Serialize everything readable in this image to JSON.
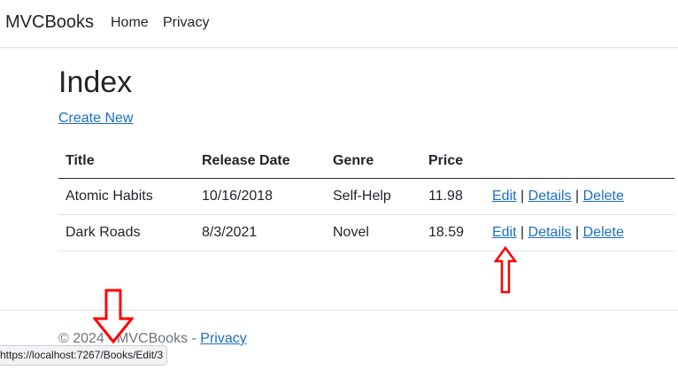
{
  "navbar": {
    "brand": "MVCBooks",
    "links": [
      "Home",
      "Privacy"
    ]
  },
  "main": {
    "heading": "Index",
    "create_link": "Create New",
    "table": {
      "headers": [
        "Title",
        "Release Date",
        "Genre",
        "Price"
      ],
      "rows": [
        {
          "title": "Atomic Habits",
          "release_date": "10/16/2018",
          "genre": "Self-Help",
          "price": "11.98"
        },
        {
          "title": "Dark Roads",
          "release_date": "8/3/2021",
          "genre": "Novel",
          "price": "18.59"
        }
      ],
      "actions": {
        "edit": "Edit",
        "details": "Details",
        "delete": "Delete",
        "separator": "|"
      }
    }
  },
  "footer": {
    "text": "© 2024 - MVCBooks - ",
    "privacy_link": "Privacy"
  },
  "statusbar": {
    "url": "https://localhost:7267/Books/Edit/3"
  },
  "annotations": {
    "arrow_color": "#ff0000",
    "arrows": [
      {
        "name": "up-arrow-icon",
        "points_to": "Edit link of row 2"
      },
      {
        "name": "down-arrow-icon",
        "points_to": "status bar URL"
      }
    ]
  },
  "colors": {
    "link": "#1b6ec2",
    "text": "#212529",
    "muted": "#6c757d"
  }
}
